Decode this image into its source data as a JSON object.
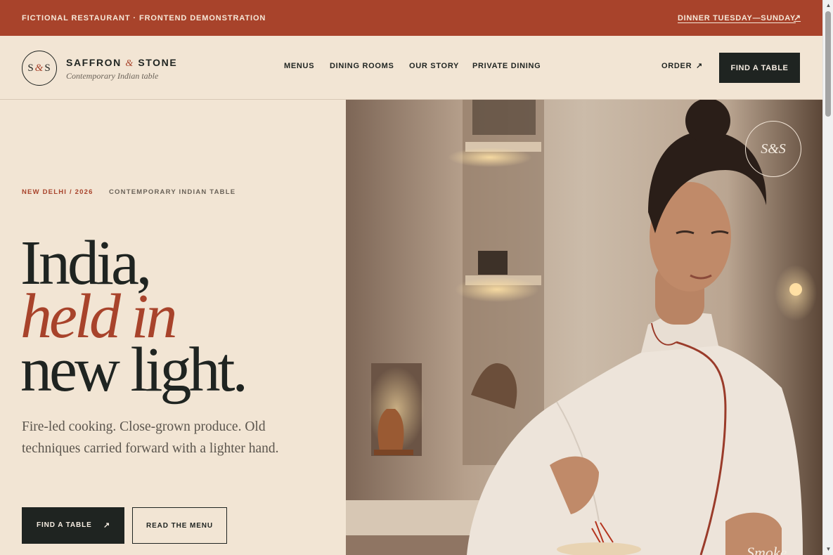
{
  "topbar": {
    "note": "FICTIONAL RESTAURANT · FRONTEND DEMONSTRATION",
    "hours": "DINNER TUESDAY—SUNDAY",
    "hours_arrow": "↗"
  },
  "header": {
    "logo": {
      "left": "S",
      "amp": "&",
      "right": "S"
    },
    "brand": {
      "name_left": "SAFFRON ",
      "amp": "&",
      "name_right": " STONE",
      "tagline": "Contemporary Indian table"
    },
    "nav": [
      "MENUS",
      "DINING ROOMS",
      "OUR STORY",
      "PRIVATE DINING"
    ],
    "order": "ORDER",
    "order_arrow": "↗",
    "cta": "FIND A TABLE"
  },
  "hero": {
    "kicker_location": "NEW DELHI / 2026",
    "kicker_tagline": "CONTEMPORARY INDIAN TABLE",
    "headline": {
      "line1": "India,",
      "line2": "held in",
      "line3": "new light."
    },
    "lede": "Fire-led cooking. Close-grown produce. Old techniques carried forward with a lighter hand.",
    "primary_cta": "FIND A TABLE",
    "primary_cta_arrow": "↗",
    "secondary_cta": "READ THE MENU",
    "seal": "S&S",
    "caption": "Smoke"
  },
  "colors": {
    "accent": "#a8432b",
    "ink": "#1f2421",
    "cream": "#f2e5d4"
  },
  "scrollbar": {
    "up": "▲",
    "down": "▼"
  }
}
